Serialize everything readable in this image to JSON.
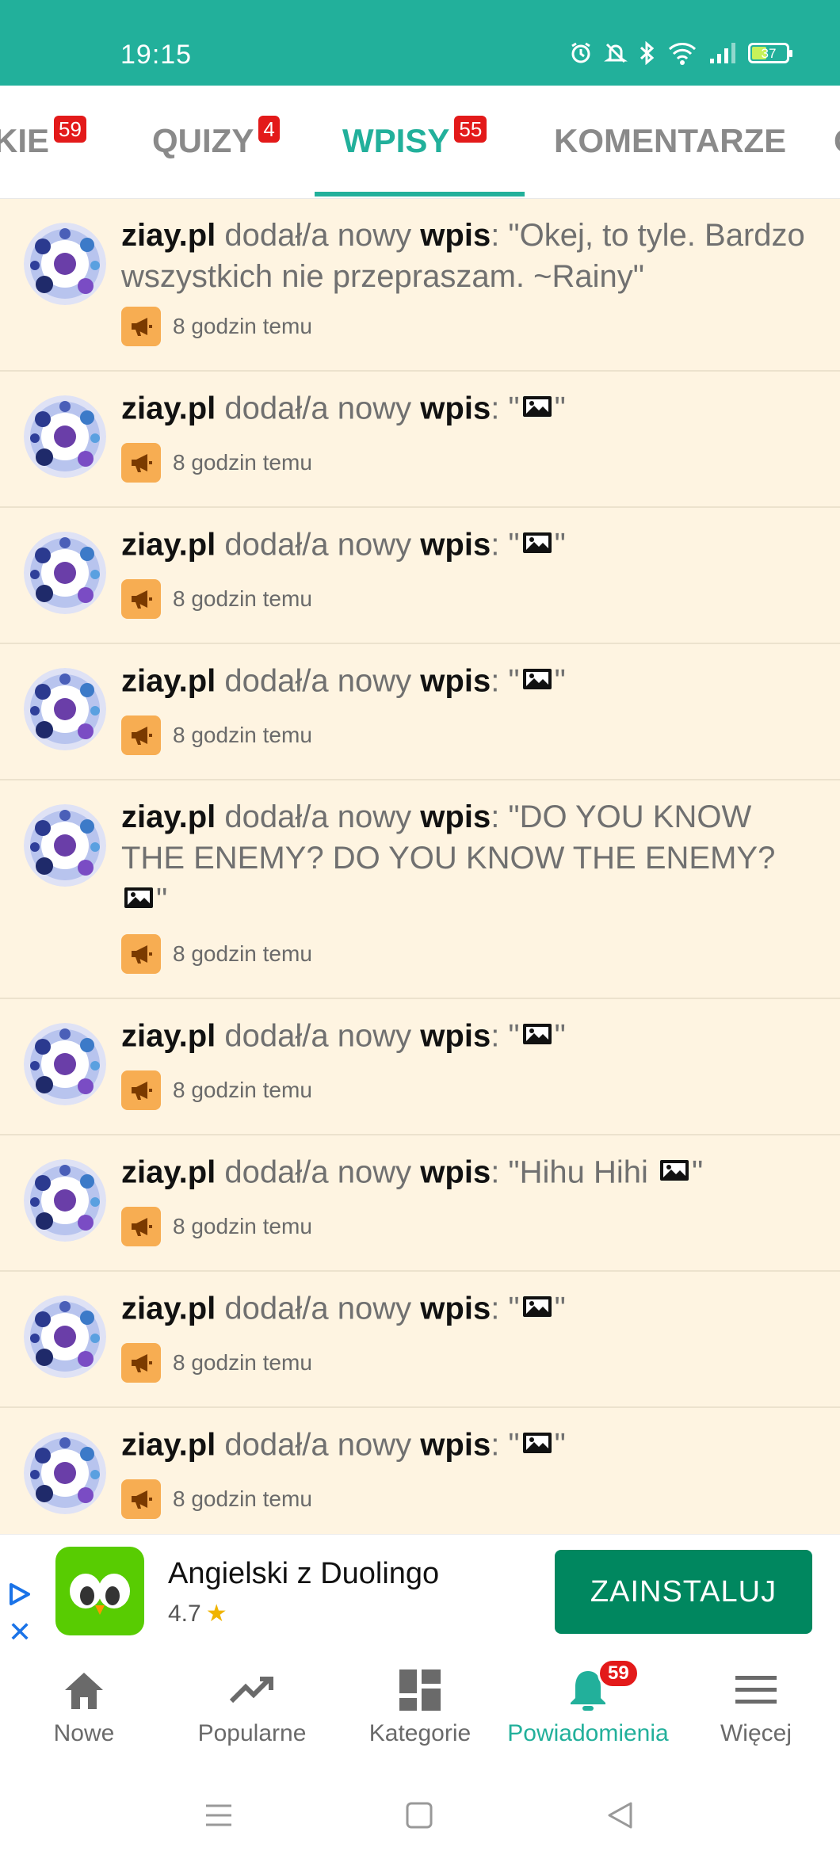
{
  "status_bar": {
    "time": "19:15",
    "battery": "37"
  },
  "tabs": [
    {
      "label": "KIE",
      "badge": "59"
    },
    {
      "label": "QUIZY",
      "badge": "4"
    },
    {
      "label": "WPISY",
      "badge": "55"
    },
    {
      "label": "KOMENTARZE",
      "badge": ""
    },
    {
      "label": "O",
      "badge": ""
    }
  ],
  "notifications": [
    {
      "user": "ziay.pl",
      "action": "dodał/a nowy",
      "kind": "wpis",
      "text_before": ": \"Okej, to tyle. Bardzo wszystkich nie przepraszam. ~Rainy\"",
      "time": "8 godzin temu"
    },
    {
      "user": "ziay.pl",
      "action": "dodał/a nowy",
      "kind": "wpis",
      "text_before": ": \"",
      "text_after": "\"",
      "time": "8 godzin temu"
    },
    {
      "user": "ziay.pl",
      "action": "dodał/a nowy",
      "kind": "wpis",
      "text_before": ": \"",
      "text_after": "\"",
      "time": "8 godzin temu"
    },
    {
      "user": "ziay.pl",
      "action": "dodał/a nowy",
      "kind": "wpis",
      "text_before": ": \"",
      "text_after": "\"",
      "time": "8 godzin temu"
    },
    {
      "user": "ziay.pl",
      "action": "dodał/a nowy",
      "kind": "wpis",
      "text_before": ": \"DO YOU KNOW THE ENEMY? DO YOU KNOW THE ENEMY? ",
      "text_after": "\"",
      "time": "8 godzin temu"
    },
    {
      "user": "ziay.pl",
      "action": "dodał/a nowy",
      "kind": "wpis",
      "text_before": ": \"",
      "text_after": "\"",
      "time": "8 godzin temu"
    },
    {
      "user": "ziay.pl",
      "action": "dodał/a nowy",
      "kind": "wpis",
      "text_before": ": \"Hihu Hihi ",
      "text_after": "\"",
      "time": "8 godzin temu"
    },
    {
      "user": "ziay.pl",
      "action": "dodał/a nowy",
      "kind": "wpis",
      "text_before": ": \"",
      "text_after": "\"",
      "time": "8 godzin temu"
    },
    {
      "user": "ziay.pl",
      "action": "dodał/a nowy",
      "kind": "wpis",
      "text_before": ": \"",
      "text_after": "\"",
      "time": "8 godzin temu"
    }
  ],
  "ad": {
    "title": "Angielski z Duolingo",
    "rating": "4.7",
    "star": "★",
    "close": "✕",
    "install_label": "ZAINSTALUJ"
  },
  "bottom_nav": [
    {
      "label": "Nowe",
      "icon": "home-icon"
    },
    {
      "label": "Popularne",
      "icon": "trending-icon"
    },
    {
      "label": "Kategorie",
      "icon": "grid-icon"
    },
    {
      "label": "Powiadomienia",
      "icon": "bell-icon",
      "badge": "59"
    },
    {
      "label": "Więcej",
      "icon": "menu-icon"
    }
  ],
  "colors": {
    "accent": "#22b09b",
    "badge": "#e31a1a",
    "item_bg": "#fef4e1",
    "install": "#00875f"
  }
}
